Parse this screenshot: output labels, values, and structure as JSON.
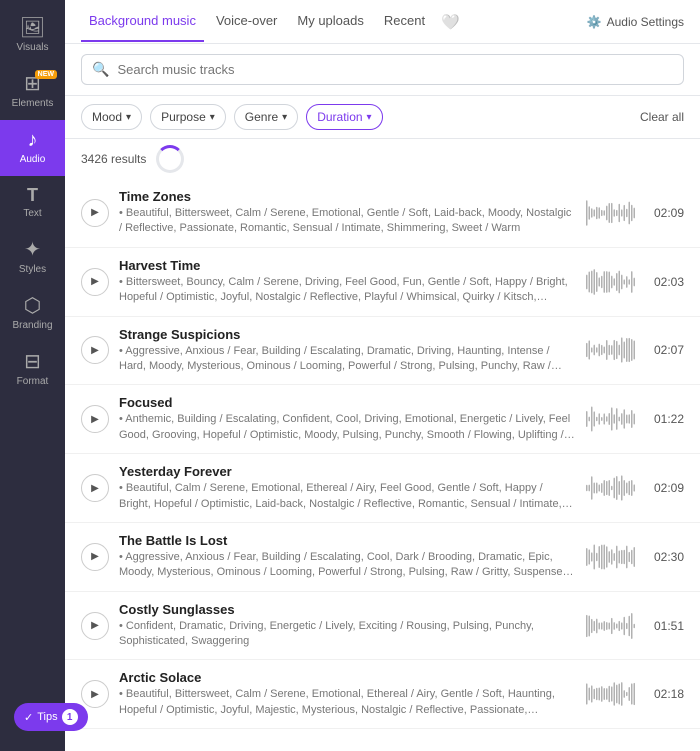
{
  "sidebar": {
    "items": [
      {
        "id": "visuals",
        "label": "Visuals",
        "icon": "🖼",
        "active": false
      },
      {
        "id": "elements",
        "label": "Elements",
        "icon": "⊞",
        "active": false,
        "badge": "NEW"
      },
      {
        "id": "audio",
        "label": "Audio",
        "icon": "♪",
        "active": true
      },
      {
        "id": "text",
        "label": "Text",
        "icon": "T",
        "active": false
      },
      {
        "id": "styles",
        "label": "Styles",
        "icon": "✦",
        "active": false
      },
      {
        "id": "branding",
        "label": "Branding",
        "icon": "⬡",
        "active": false
      },
      {
        "id": "format",
        "label": "Format",
        "icon": "⊟",
        "active": false
      }
    ]
  },
  "nav": {
    "tabs": [
      {
        "id": "background-music",
        "label": "Background music",
        "active": true
      },
      {
        "id": "voice-over",
        "label": "Voice-over",
        "active": false
      },
      {
        "id": "my-uploads",
        "label": "My uploads",
        "active": false
      },
      {
        "id": "recent",
        "label": "Recent",
        "active": false
      }
    ],
    "audio_settings_label": "Audio Settings"
  },
  "search": {
    "placeholder": "Search music tracks"
  },
  "filters": {
    "mood_label": "Mood",
    "purpose_label": "Purpose",
    "genre_label": "Genre",
    "duration_label": "Duration",
    "clear_label": "Clear all"
  },
  "results": {
    "count": "3426 results"
  },
  "tracks": [
    {
      "name": "Time Zones",
      "tags": "• Beautiful, Bittersweet, Calm / Serene, Emotional, Gentle / Soft, Laid-back, Moody, Nostalgic / Reflective, Passionate, Romantic, Sensual / Intimate, Shimmering, Sweet / Warm",
      "duration": "02:09"
    },
    {
      "name": "Harvest Time",
      "tags": "• Bittersweet, Bouncy, Calm / Serene, Driving, Feel Good, Fun, Gentle / Soft, Happy / Bright, Hopeful / Optimistic, Joyful, Nostalgic / Reflective, Playful / Whimsical, Quirky / Kitsch, Romantic, Smooth / Flowing, Sweet / Warm, Upbeat / Cheerful",
      "duration": "02:03"
    },
    {
      "name": "Strange Suspicions",
      "tags": "• Aggressive, Anxious / Fear, Building / Escalating, Dramatic, Driving, Haunting, Intense / Hard, Moody, Mysterious, Ominous / Looming, Powerful / Strong, Pulsing, Punchy, Raw / Gritty, Suspense / Tense",
      "duration": "02:07"
    },
    {
      "name": "Focused",
      "tags": "• Anthemic, Building / Escalating, Confident, Cool, Driving, Emotional, Energetic / Lively, Feel Good, Grooving, Hopeful / Optimistic, Moody, Pulsing, Punchy, Smooth / Flowing, Uplifting / Inspiring",
      "duration": "01:22"
    },
    {
      "name": "Yesterday Forever",
      "tags": "• Beautiful, Calm / Serene, Emotional, Ethereal / Airy, Feel Good, Gentle / Soft, Happy / Bright, Hopeful / Optimistic, Laid-back, Nostalgic / Reflective, Romantic, Sensual / Intimate, Shimmering, Sophisticated, Sweet / Warm",
      "duration": "02:09"
    },
    {
      "name": "The Battle Is Lost",
      "tags": "• Aggressive, Anxious / Fear, Building / Escalating, Cool, Dark / Brooding, Dramatic, Epic, Moody, Mysterious, Ominous / Looming, Powerful / Strong, Pulsing, Raw / Gritty, Suspense / Tense, Swaggering",
      "duration": "02:30"
    },
    {
      "name": "Costly Sunglasses",
      "tags": "• Confident, Dramatic, Driving, Energetic / Lively, Exciting / Rousing, Pulsing, Punchy, Sophisticated, Swaggering",
      "duration": "01:51"
    },
    {
      "name": "Arctic Solace",
      "tags": "• Beautiful, Bittersweet, Calm / Serene, Emotional, Ethereal / Airy, Gentle / Soft, Haunting, Hopeful / Optimistic, Joyful, Majestic, Mysterious, Nostalgic / Reflective, Passionate, Romantic, Sensual / Intimate, Smooth / Flowing, Sweet / Warm, Uplifting / Inspiring",
      "duration": "02:18"
    }
  ],
  "tips": {
    "label": "Tips",
    "count": "1"
  }
}
